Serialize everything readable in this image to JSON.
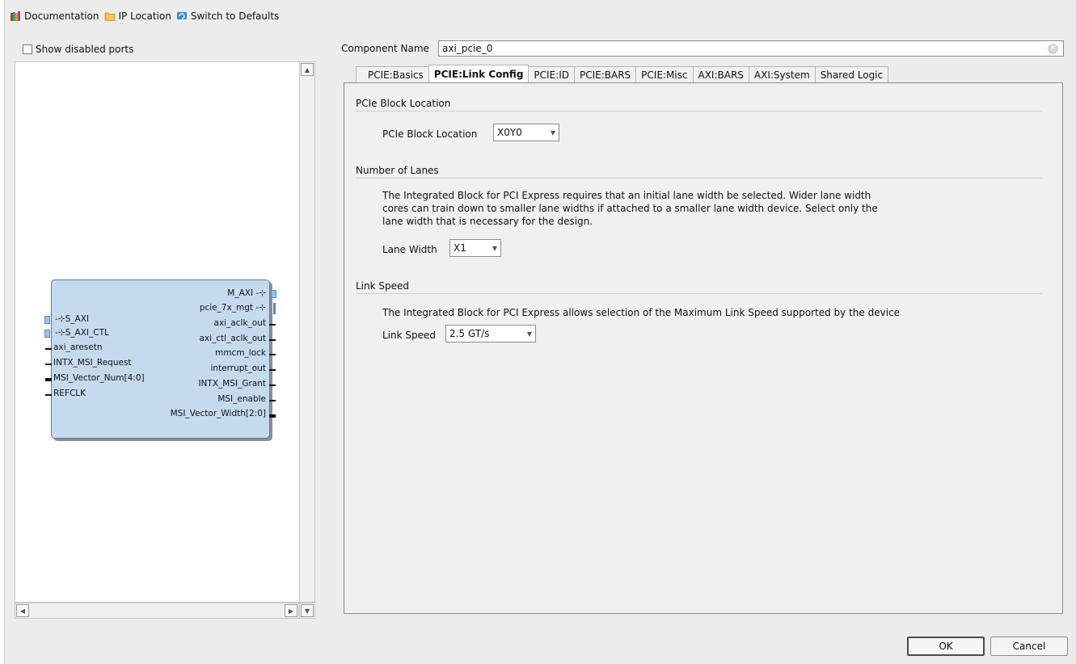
{
  "toolbar": {
    "documentation": "Documentation",
    "ip_location": "IP Location",
    "switch_defaults": "Switch to Defaults"
  },
  "left": {
    "show_disabled_ports": "Show disabled ports",
    "block": {
      "left_ports": [
        "S_AXI",
        "S_AXI_CTL",
        "axi_aresetn",
        "INTX_MSI_Request",
        "MSI_Vector_Num[4:0]",
        "REFCLK"
      ],
      "right_ports": [
        "M_AXI",
        "pcie_7x_mgt",
        "axi_aclk_out",
        "axi_ctl_aclk_out",
        "mmcm_lock",
        "interrupt_out",
        "INTX_MSI_Grant",
        "MSI_enable",
        "MSI_Vector_Width[2:0]"
      ]
    }
  },
  "component": {
    "label": "Component Name",
    "value": "axi_pcie_0"
  },
  "tabs": [
    "PCIE:Basics",
    "PCIE:Link Config",
    "PCIE:ID",
    "PCIE:BARS",
    "PCIE:Misc",
    "AXI:BARS",
    "AXI:System",
    "Shared Logic"
  ],
  "active_tab": "PCIE:Link Config",
  "sections": {
    "block_location": {
      "title": "PCIe Block Location",
      "field_label": "PCIe Block Location",
      "value": "X0Y0"
    },
    "lanes": {
      "title": "Number of Lanes",
      "desc_line1": "The Integrated Block for PCI Express requires that an initial lane width be selected. Wider lane width",
      "desc_line2": "cores can train down to smaller lane widths if attached to a smaller lane width device. Select only the",
      "desc_line3": "lane width that is necessary for the design.",
      "field_label": "Lane Width",
      "value": "X1"
    },
    "speed": {
      "title": "Link Speed",
      "desc": "The Integrated Block for PCI Express allows selection of the Maximum Link Speed supported by the device",
      "field_label": "Link Speed",
      "value": "2.5 GT/s"
    }
  },
  "buttons": {
    "ok": "OK",
    "cancel": "Cancel"
  }
}
